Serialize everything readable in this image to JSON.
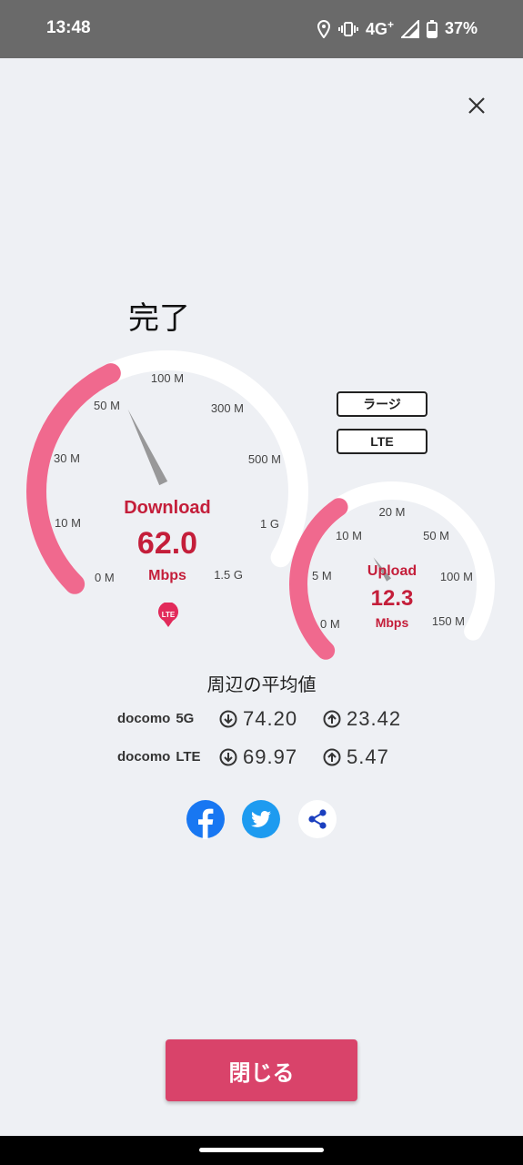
{
  "status_bar": {
    "time": "13:48",
    "network": "4G",
    "network_plus": "+",
    "battery": "37%"
  },
  "title": "完了",
  "download_gauge": {
    "label": "Download",
    "value": 62.0,
    "value_text": "62.0",
    "unit": "Mbps",
    "ticks": [
      "0 M",
      "10 M",
      "30 M",
      "50 M",
      "100 M",
      "300 M",
      "500 M",
      "1 G",
      "1.5 G"
    ]
  },
  "upload_gauge": {
    "label": "Upload",
    "value": 12.3,
    "value_text": "12.3",
    "unit": "Mbps",
    "ticks": [
      "0 M",
      "5 M",
      "10 M",
      "20 M",
      "50 M",
      "100 M",
      "150 M"
    ]
  },
  "mode_buttons": {
    "size": "ラージ",
    "network": "LTE"
  },
  "network_badge": "LTE",
  "averages": {
    "title": "周辺の平均値",
    "rows": [
      {
        "carrier": "docomo",
        "tech": "5G",
        "download": "74.20",
        "upload": "23.42"
      },
      {
        "carrier": "docomo",
        "tech": "LTE",
        "download": "69.97",
        "upload": "5.47"
      }
    ]
  },
  "share_icons": [
    "facebook-icon",
    "twitter-icon",
    "share-icon"
  ],
  "close_button": "閉じる",
  "colors": {
    "accent": "#f0698e",
    "accent_text": "#c41e3a",
    "button": "#d9436a",
    "background": "#eef0f4"
  }
}
